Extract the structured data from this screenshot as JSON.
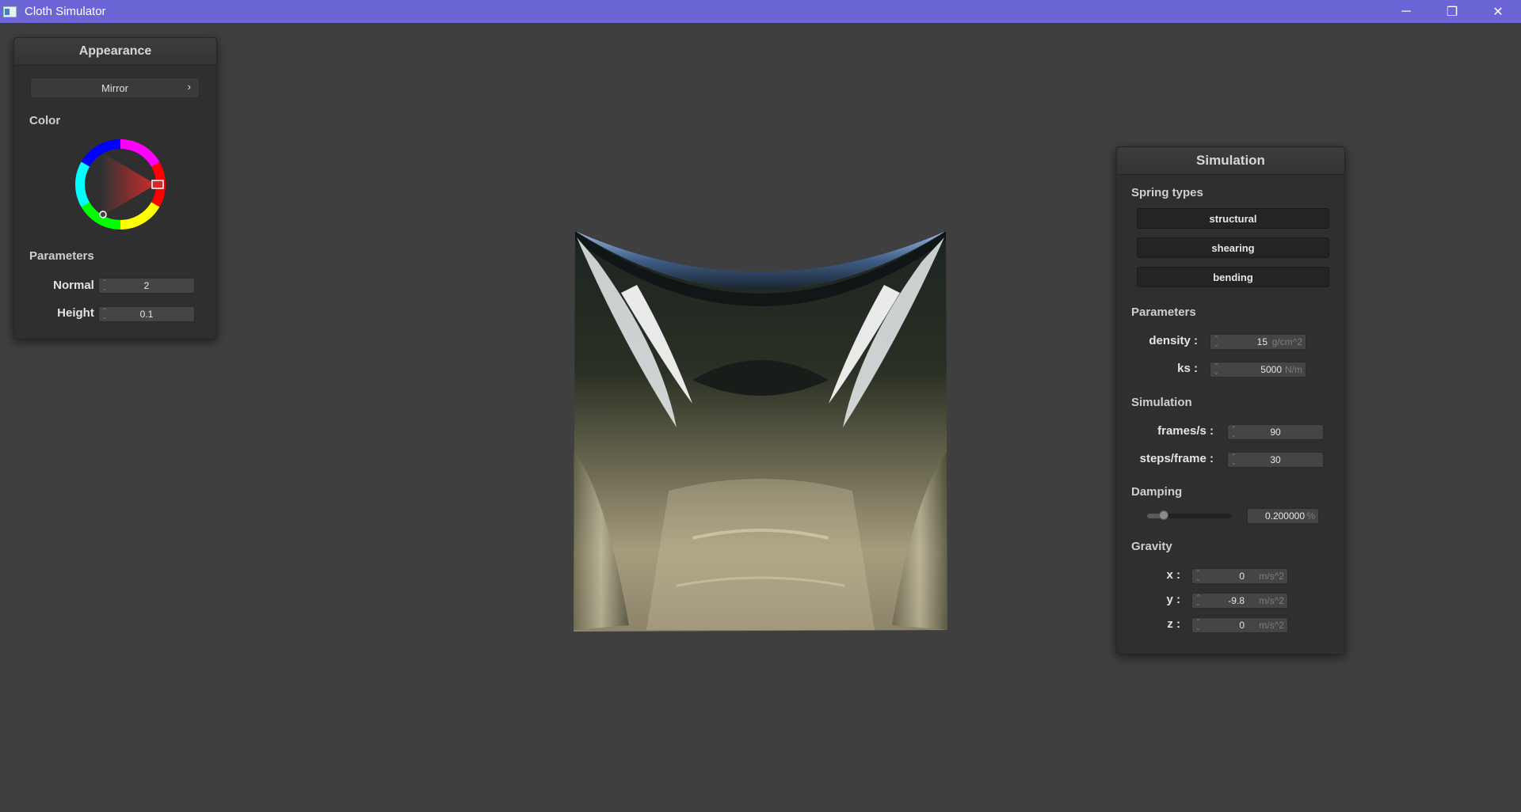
{
  "window": {
    "title": "Cloth Simulator",
    "controls": {
      "minimize": "─",
      "maximize": "❐",
      "close": "✕"
    }
  },
  "appearance": {
    "header": "Appearance",
    "shader_select": "Mirror",
    "shader_arrow": "›",
    "color_label": "Color",
    "color_selected": "#d22a2a",
    "params_label": "Parameters",
    "normal": {
      "label": "Normal :",
      "value": "2"
    },
    "height": {
      "label": "Height :",
      "value": "0.1"
    }
  },
  "simulation": {
    "header": "Simulation",
    "spring_types_label": "Spring types",
    "springs": [
      "structural",
      "shearing",
      "bending"
    ],
    "params_label": "Parameters",
    "density": {
      "label": "density :",
      "value": "15",
      "unit": "g/cm^2"
    },
    "ks": {
      "label": "ks :",
      "value": "5000",
      "unit": "N/m"
    },
    "sim_label": "Simulation",
    "fps": {
      "label": "frames/s :",
      "value": "90"
    },
    "steps": {
      "label": "steps/frame :",
      "value": "30"
    },
    "damping_label": "Damping",
    "damping": {
      "value": "0.200000",
      "unit": "%",
      "fraction": 0.2
    },
    "gravity_label": "Gravity",
    "gx": {
      "label": "x :",
      "value": "0",
      "unit": "m/s^2"
    },
    "gy": {
      "label": "y :",
      "value": "-9.8",
      "unit": "m/s^2"
    },
    "gz": {
      "label": "z :",
      "value": "0",
      "unit": "m/s^2"
    }
  }
}
